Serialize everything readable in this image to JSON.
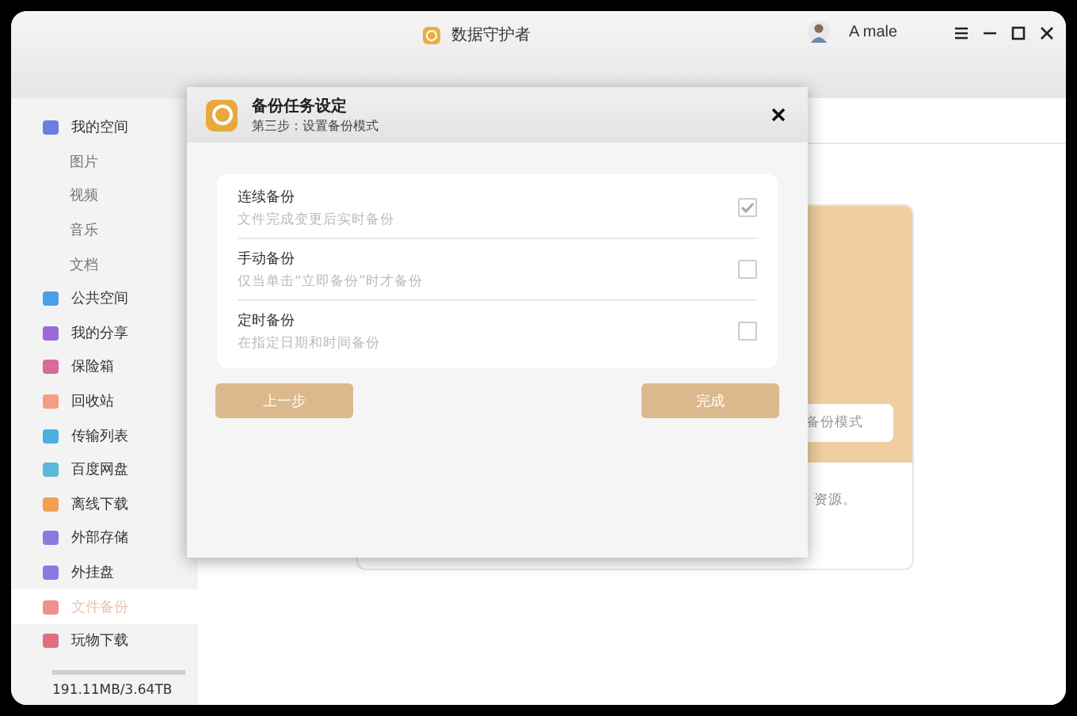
{
  "window": {
    "title": "数据守护者",
    "user": "A male"
  },
  "sidebar": {
    "items": [
      {
        "kind": "main",
        "label": "我的空间",
        "color": "#6b7fe0",
        "selected": false
      },
      {
        "kind": "sub",
        "label": "图片",
        "selected": false
      },
      {
        "kind": "sub",
        "label": "视频",
        "selected": false
      },
      {
        "kind": "sub",
        "label": "音乐",
        "selected": false
      },
      {
        "kind": "sub",
        "label": "文档",
        "selected": false
      },
      {
        "kind": "main",
        "label": "公共空间",
        "color": "#4a9fe8",
        "selected": false
      },
      {
        "kind": "main",
        "label": "我的分享",
        "color": "#9a6bd8",
        "selected": false
      },
      {
        "kind": "main",
        "label": "保险箱",
        "color": "#d86b9a",
        "selected": false
      },
      {
        "kind": "main",
        "label": "回收站",
        "color": "#f0a080",
        "selected": false
      },
      {
        "kind": "main",
        "label": "传输列表",
        "color": "#4ab0e0",
        "selected": false
      },
      {
        "kind": "main",
        "label": "百度网盘",
        "color": "#5ab8d8",
        "selected": false
      },
      {
        "kind": "main",
        "label": "离线下载",
        "color": "#f0a050",
        "selected": false
      },
      {
        "kind": "main",
        "label": "外部存储",
        "color": "#8a7ae0",
        "selected": false
      },
      {
        "kind": "main",
        "label": "外挂盘",
        "color": "#8a7ae0",
        "selected": false
      },
      {
        "kind": "main",
        "label": "文件备份",
        "color": "#f09090",
        "selected": true
      },
      {
        "kind": "main",
        "label": "玩物下载",
        "color": "#e07080",
        "selected": false
      }
    ],
    "storage": "191.11MB/3.64TB"
  },
  "background_card": {
    "mode_field": "备份模式",
    "note": "资源。"
  },
  "dialog": {
    "title": "备份任务设定",
    "subtitle": "第三步：设置备份模式",
    "options": [
      {
        "label": "连续备份",
        "description": "文件完成变更后实时备份",
        "checked": true
      },
      {
        "label": "手动备份",
        "description": "仅当单击“立即备份”时才备份",
        "checked": false
      },
      {
        "label": "定时备份",
        "description": "在指定日期和时间备份",
        "checked": false
      }
    ],
    "buttons": [
      "上一步",
      "完成"
    ]
  }
}
